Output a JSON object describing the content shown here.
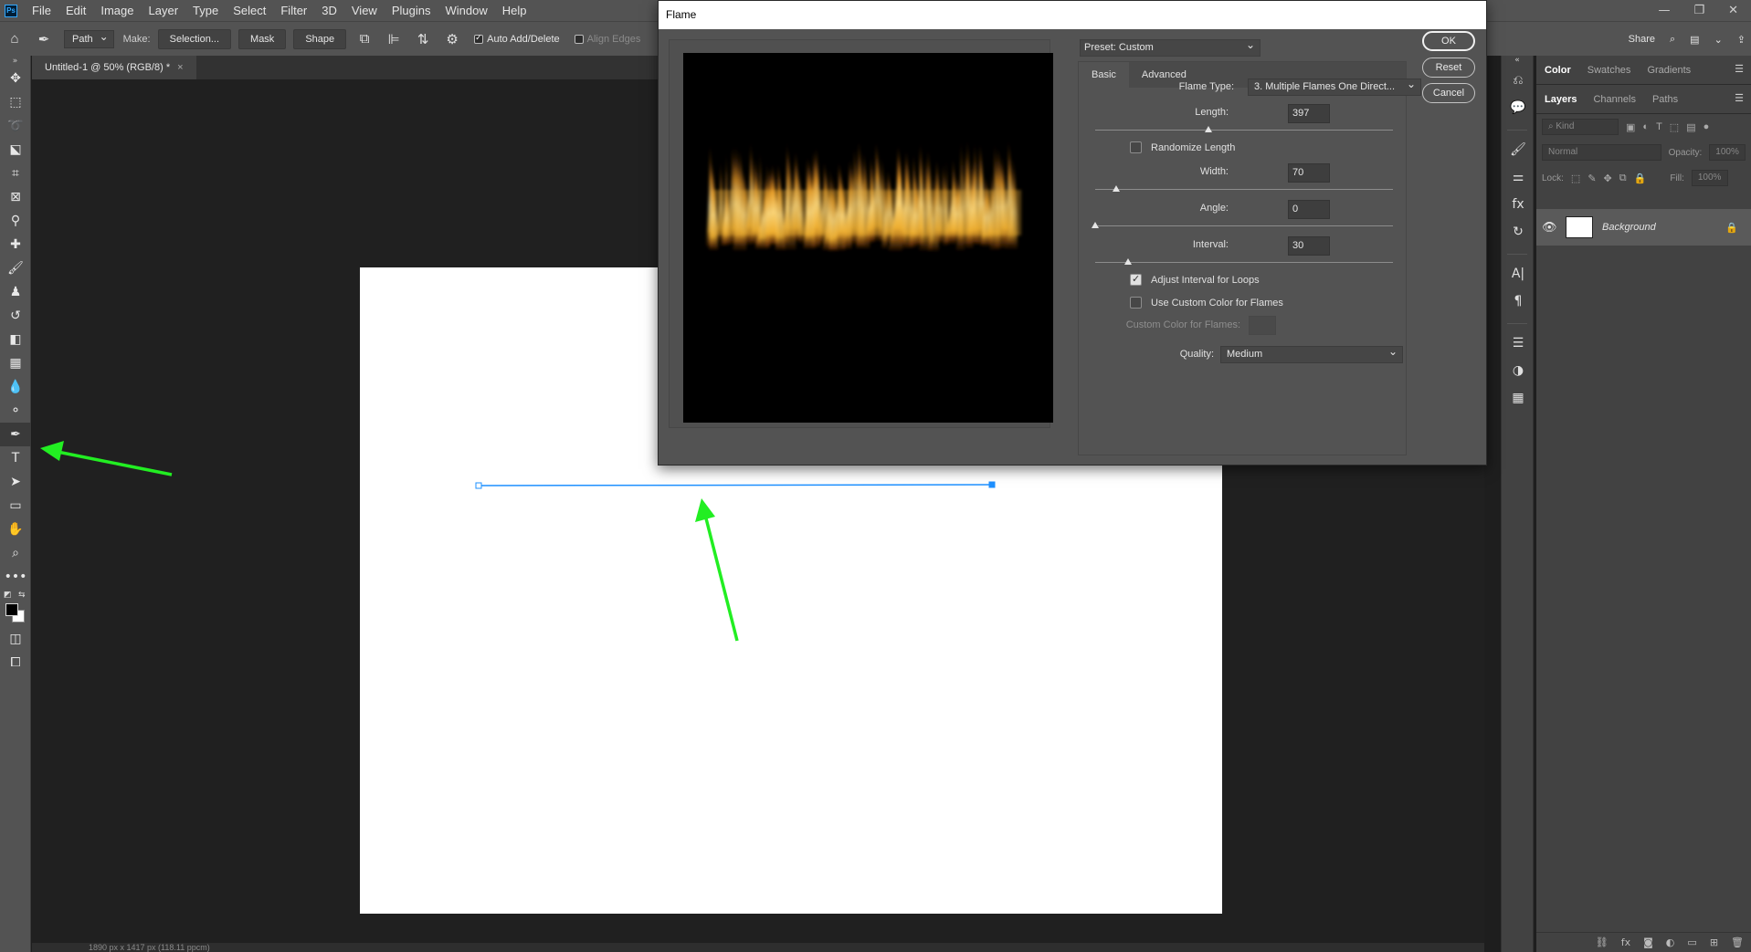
{
  "menubar": {
    "app_logo": "Ps",
    "items": [
      "File",
      "Edit",
      "Image",
      "Layer",
      "Type",
      "Select",
      "Filter",
      "3D",
      "View",
      "Plugins",
      "Window",
      "Help"
    ],
    "window_controls": [
      "—",
      "❐",
      "✕"
    ]
  },
  "options_bar": {
    "mode": "Path",
    "make_label": "Make:",
    "selection_btn": "Selection...",
    "mask_btn": "Mask",
    "shape_btn": "Shape",
    "auto_add_delete": "Auto Add/Delete",
    "auto_add_delete_checked": true,
    "align_edges": "Align Edges",
    "share": "Share"
  },
  "document": {
    "tab_title": "Untitled-1 @ 50% (RGB/8) *",
    "status": "1890 px x 1417 px (118.11 ppcm)"
  },
  "flame_dialog": {
    "title": "Flame",
    "preset": "Preset: Custom",
    "tabs": [
      "Basic",
      "Advanced"
    ],
    "active_tab": "Basic",
    "flame_type_label": "Flame Type:",
    "flame_type": "3. Multiple Flames One Direct...",
    "length_label": "Length:",
    "length": "397",
    "randomize_length": "Randomize Length",
    "randomize_length_checked": false,
    "width_label": "Width:",
    "width": "70",
    "angle_label": "Angle:",
    "angle": "0",
    "interval_label": "Interval:",
    "interval": "30",
    "adjust_interval": "Adjust Interval for Loops",
    "adjust_interval_checked": true,
    "use_custom_color": "Use Custom Color for Flames",
    "use_custom_color_checked": false,
    "custom_color_label": "Custom Color for Flames:",
    "quality_label": "Quality:",
    "quality": "Medium",
    "ok": "OK",
    "reset": "Reset",
    "cancel": "Cancel",
    "sliders": {
      "length": 0.38,
      "width": 0.07,
      "angle": 0.0,
      "interval": 0.11
    }
  },
  "panels": {
    "top_tabs": [
      "Color",
      "Swatches",
      "Gradients"
    ],
    "top_active": "Color",
    "layer_tabs": [
      "Layers",
      "Channels",
      "Paths"
    ],
    "layer_active": "Layers",
    "kind_placeholder": "Kind",
    "blend_mode": "Normal",
    "opacity_label": "Opacity:",
    "opacity": "100%",
    "lock_label": "Lock:",
    "fill_label": "Fill:",
    "fill": "100%",
    "layer_name": "Background"
  },
  "colors": {
    "annotation_arrow": "#22ee22",
    "path_line": "#1e90ff",
    "flame_core": "#fff2b0",
    "flame_mid": "#f0b030",
    "flame_edge": "#9a4a10"
  }
}
